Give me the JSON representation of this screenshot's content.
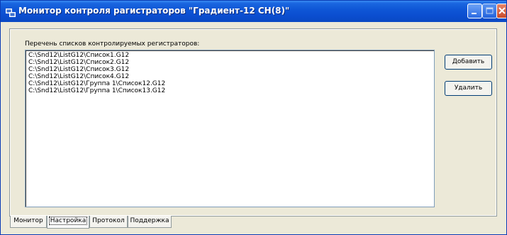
{
  "window": {
    "title": "Монитор контроля рагистраторов \"Градиент-12 СН(8)\"",
    "app_icon": "network-computer-icon",
    "controls": {
      "minimize": "minimize-icon",
      "maximize": "maximize-icon",
      "close": "close-icon"
    }
  },
  "panel": {
    "list_label": "Перечень списков контролируемых регистраторов:",
    "list_items": [
      "C:\\Snd12\\ListG12\\Список1.G12",
      "C:\\Snd12\\ListG12\\Список2.G12",
      "C:\\Snd12\\ListG12\\Список3.G12",
      "C:\\Snd12\\ListG12\\Список4.G12",
      "C:\\Snd12\\ListG12\\Группа 1\\Список12.G12",
      "C:\\Snd12\\ListG12\\Группа 1\\Список13.G12"
    ],
    "buttons": {
      "add": "Добавить",
      "delete": "Удалить"
    }
  },
  "tabs": [
    {
      "label": "Монитор",
      "active": false
    },
    {
      "label": "Настройка",
      "active": true
    },
    {
      "label": "Протокол",
      "active": false
    },
    {
      "label": "Поддержка",
      "active": false
    }
  ],
  "colors": {
    "titlebar": "#0b4ed0",
    "face": "#ece9d8",
    "close_button": "#c94a2a"
  }
}
